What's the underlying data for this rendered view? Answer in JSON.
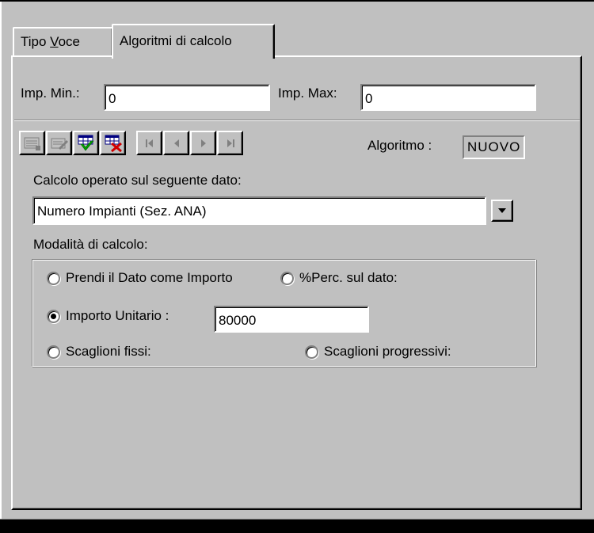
{
  "tabs": [
    {
      "label_prefix": "Tipo ",
      "label_underline": "V",
      "label_suffix": "oce"
    },
    {
      "label": "Algoritmi di calcolo"
    }
  ],
  "imp_min": {
    "label": "Imp. Min.:",
    "value": "0"
  },
  "imp_max": {
    "label": "Imp. Max:",
    "value": "0"
  },
  "toolbar": {
    "icons": [
      "new-record-icon",
      "edit-record-icon",
      "save-record-icon",
      "delete-record-icon",
      "first-record-icon",
      "previous-record-icon",
      "next-record-icon",
      "last-record-icon"
    ]
  },
  "algoritmo": {
    "label": "Algoritmo :",
    "value": "NUOVO"
  },
  "calcolo": {
    "label": "Calcolo operato sul seguente dato:",
    "selected": "Numero Impianti (Sez. ANA)"
  },
  "modalita": {
    "label": "Modalità di  calcolo:",
    "options": {
      "prendi": "Prendi il Dato come Importo",
      "perc": "%Perc. sul dato:",
      "unitario": "Importo Unitario :",
      "fissi": "Scaglioni fissi:",
      "progressivi": "Scaglioni progressivi:"
    },
    "selected": "unitario",
    "importo_unitario_value": "80000"
  }
}
